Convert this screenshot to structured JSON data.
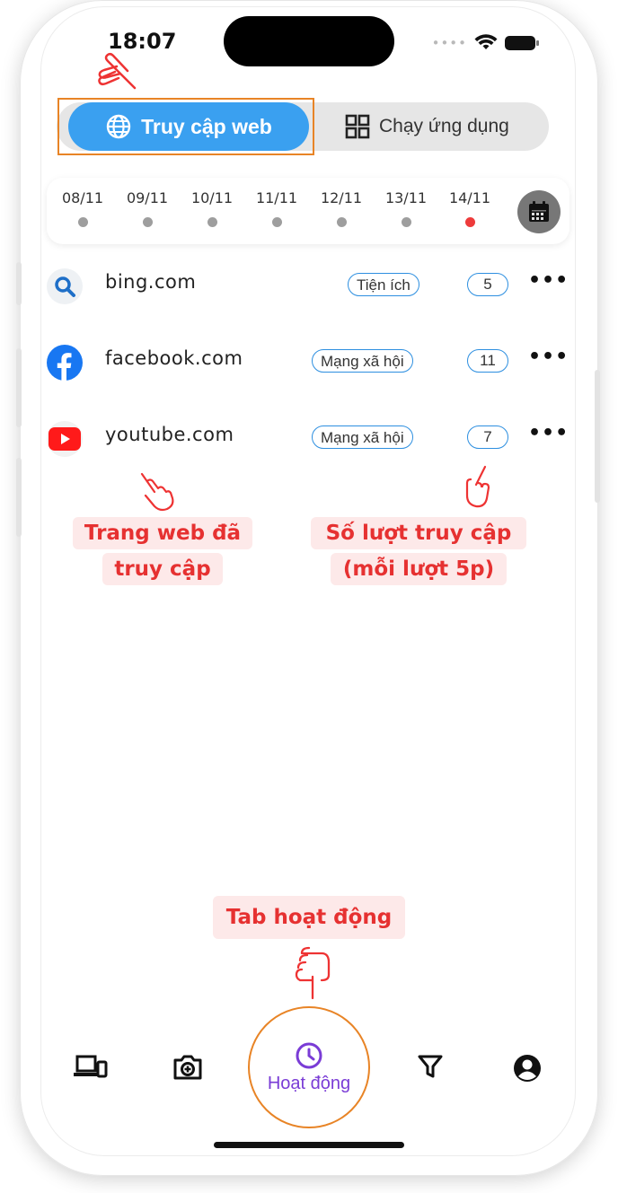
{
  "status_bar": {
    "time": "18:07"
  },
  "segment": {
    "active_label": "Truy cập web",
    "inactive_label": "Chạy ứng dụng"
  },
  "dates": [
    {
      "label": "08/11",
      "active": false
    },
    {
      "label": "09/11",
      "active": false
    },
    {
      "label": "10/11",
      "active": false
    },
    {
      "label": "11/11",
      "active": false
    },
    {
      "label": "12/11",
      "active": false
    },
    {
      "label": "13/11",
      "active": false
    },
    {
      "label": "14/11",
      "active": true
    }
  ],
  "sites": [
    {
      "name": "bing.com",
      "category": "Tiện ích",
      "count": "5",
      "icon": "search-icon"
    },
    {
      "name": "facebook.com",
      "category": "Mạng xã hội",
      "count": "11",
      "icon": "facebook-icon"
    },
    {
      "name": "youtube.com",
      "category": "Mạng xã hội",
      "count": "7",
      "icon": "youtube-icon"
    }
  ],
  "annotations": {
    "visited_line1": "Trang web đã",
    "visited_line2": "truy cập",
    "count_line1": "Số lượt truy cập",
    "count_line2": "(mỗi lượt 5p)",
    "tab_hint": "Tab hoạt động"
  },
  "bottom_nav": {
    "items": [
      "devices-icon",
      "camera-icon",
      "clock-icon",
      "filter-icon",
      "account-icon"
    ],
    "active_label": "Hoạt động"
  },
  "colors": {
    "accent": "#3aa0f0",
    "highlight": "#e88426",
    "annotation": "#e63131",
    "active_tab": "#7a3cd6",
    "date_active": "#ee3b3b"
  }
}
